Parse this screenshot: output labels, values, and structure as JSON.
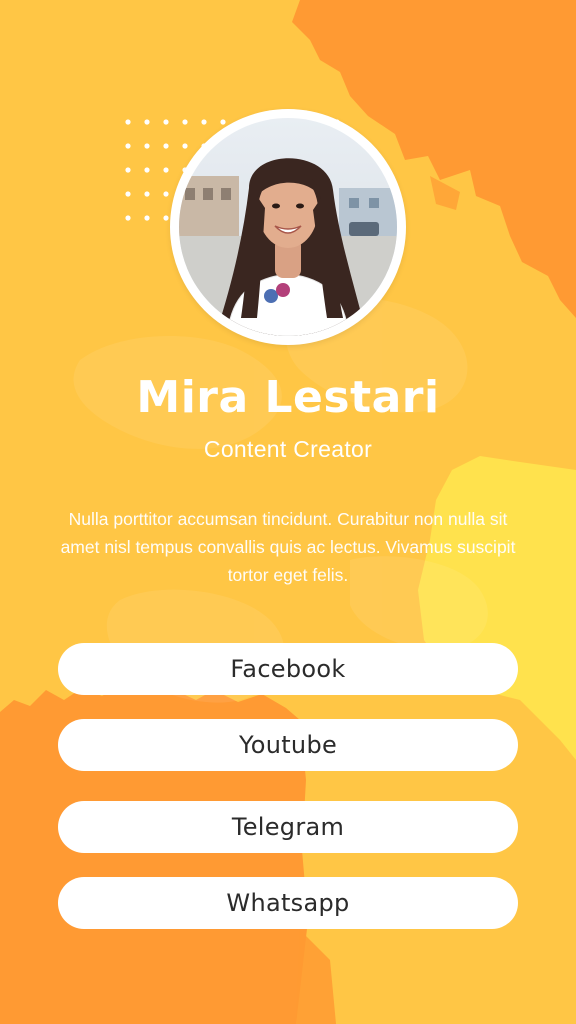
{
  "profile": {
    "name": "Mira Lestari",
    "role": "Content Creator",
    "bio": "Nulla porttitor accumsan tincidunt. Curabitur non nulla sit amet nisl tempus convallis quis ac lectus. Vivamus suscipit tortor eget felis."
  },
  "links": [
    {
      "label": "Facebook"
    },
    {
      "label": "Youtube"
    },
    {
      "label": "Telegram"
    },
    {
      "label": "Whatsapp"
    }
  ],
  "colors": {
    "background": "#FFC645",
    "orange_brush": "#FF9A33",
    "yellow_brush": "#FFE24D",
    "button": "#FFFFFF",
    "text_light": "#FFFFFF",
    "text_dark": "#2B2B2B"
  }
}
